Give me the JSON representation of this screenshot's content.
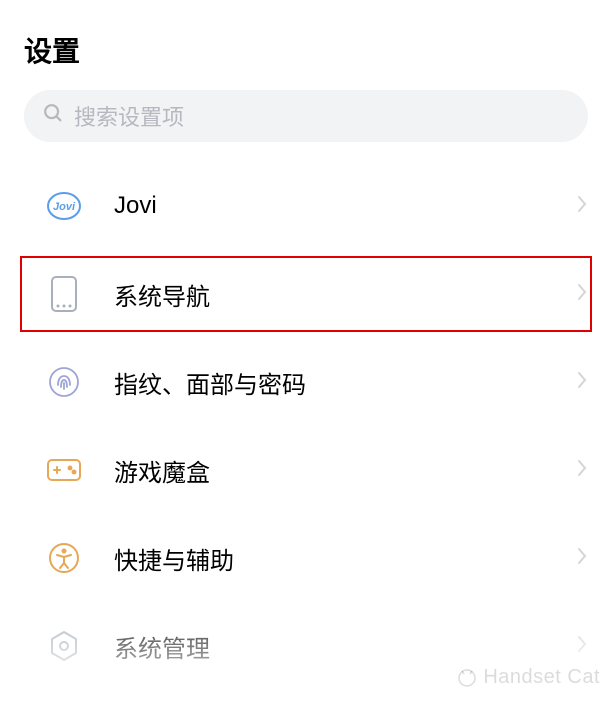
{
  "title": "设置",
  "search": {
    "placeholder": "搜索设置项"
  },
  "items": [
    {
      "label": "Jovi"
    },
    {
      "label": "系统导航"
    },
    {
      "label": "指纹、面部与密码"
    },
    {
      "label": "游戏魔盒"
    },
    {
      "label": "快捷与辅助"
    },
    {
      "label": "系统管理"
    }
  ],
  "highlight_index": 1,
  "watermark": "Handset Cat"
}
